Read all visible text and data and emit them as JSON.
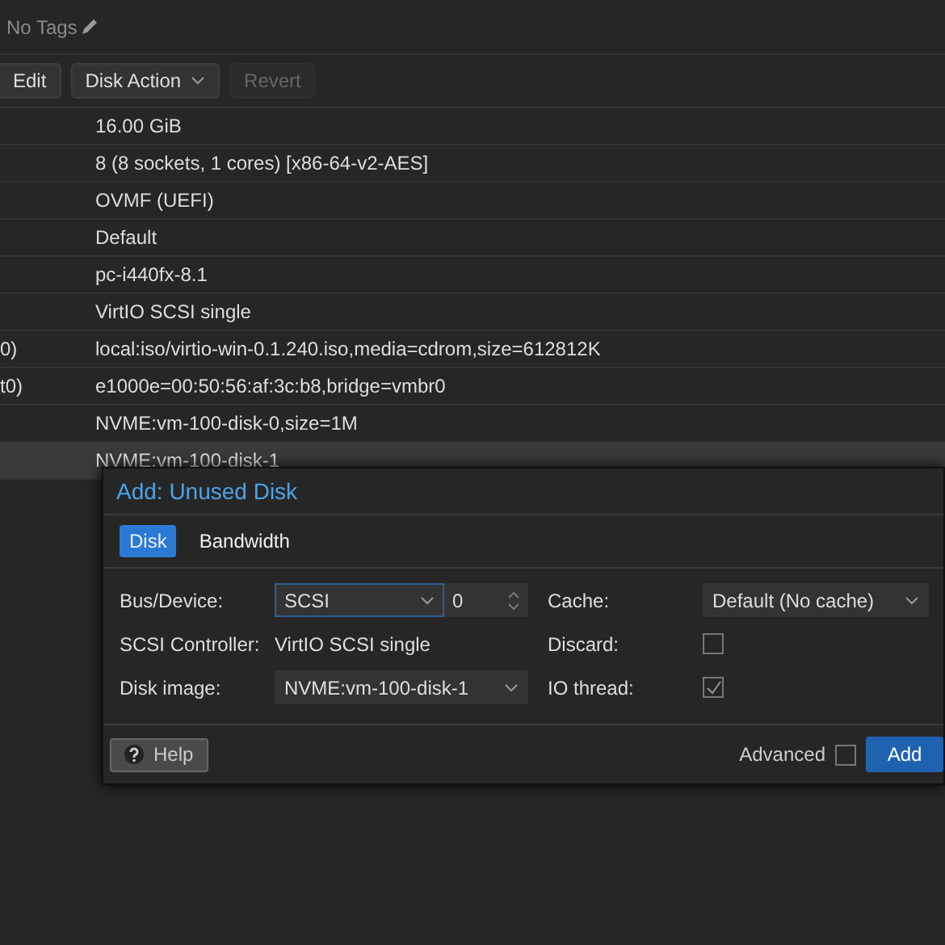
{
  "tags": {
    "label": "No Tags"
  },
  "toolbar": [
    {
      "label": "Edit",
      "kind": "button",
      "disabled": false
    },
    {
      "label": "Disk Action",
      "kind": "menu",
      "disabled": false
    },
    {
      "label": "Revert",
      "kind": "button",
      "disabled": true
    }
  ],
  "rows": [
    {
      "key": "",
      "value": "16.00 GiB",
      "selected": false
    },
    {
      "key": "",
      "value": "8 (8 sockets, 1 cores) [x86-64-v2-AES]",
      "selected": false
    },
    {
      "key": "",
      "value": "OVMF (UEFI)",
      "selected": false
    },
    {
      "key": "",
      "value": "Default",
      "selected": false
    },
    {
      "key": "",
      "value": "pc-i440fx-8.1",
      "selected": false
    },
    {
      "key": "",
      "value": "VirtIO SCSI single",
      "selected": false
    },
    {
      "key": "0)",
      "value": "local:iso/virtio-win-0.1.240.iso,media=cdrom,size=612812K",
      "selected": false
    },
    {
      "key": "t0)",
      "value": "e1000e=00:50:56:af:3c:b8,bridge=vmbr0",
      "selected": false
    },
    {
      "key": "",
      "value": "NVME:vm-100-disk-0,size=1M",
      "selected": false
    },
    {
      "key": "",
      "value": "NVME:vm-100-disk-1",
      "selected": true
    }
  ],
  "dialog": {
    "title": "Add: Unused Disk",
    "tabs": [
      {
        "label": "Disk",
        "selected": true
      },
      {
        "label": "Bandwidth",
        "selected": false
      }
    ],
    "left_fields": [
      {
        "label": "Bus/Device:",
        "kind": "bus",
        "value": "SCSI",
        "number": "0"
      },
      {
        "label": "SCSI Controller:",
        "kind": "text",
        "value": "VirtIO SCSI single"
      },
      {
        "label": "Disk image:",
        "kind": "select",
        "value": "NVME:vm-100-disk-1"
      }
    ],
    "right_fields": [
      {
        "label": "Cache:",
        "kind": "select",
        "value": "Default (No cache)"
      },
      {
        "label": "Discard:",
        "kind": "checkbox",
        "checked": false
      },
      {
        "label": "IO thread:",
        "kind": "checkbox",
        "checked": true
      }
    ],
    "help": "Help",
    "advanced": {
      "label": "Advanced",
      "checked": false
    },
    "add": "Add"
  }
}
